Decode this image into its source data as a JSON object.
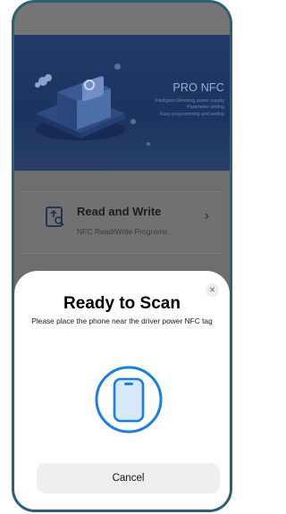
{
  "hero": {
    "title": "PRO NFC",
    "lines": [
      "Intelligent Dimming power supply",
      "Parameter setting",
      "Easy programming and setting"
    ]
  },
  "card": {
    "title": "Read and Write",
    "subtitle": "NFC Read/Write Programs",
    "icon": "nfc-read-write-icon",
    "chevron": "›"
  },
  "sheet": {
    "close": "✕",
    "title": "Ready to Scan",
    "message": "Please place the phone near the driver power NFC tag",
    "illustration": "phone-scan-icon",
    "cancel": "Cancel"
  },
  "colors": {
    "accent": "#1a7fe0",
    "phone_fill": "#d7e8fb",
    "hero_background": "#213a6a",
    "dim_overlay": "#6e6e6e"
  }
}
